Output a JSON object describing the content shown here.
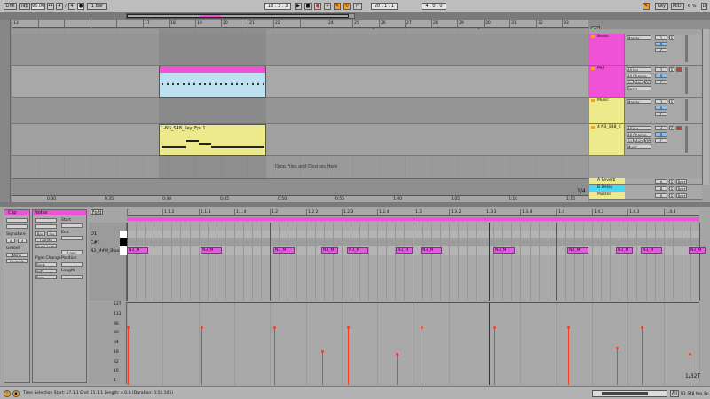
{
  "transport": {
    "link": "Link",
    "tap": "Tap",
    "tempo": "95.00",
    "meter_num": "4",
    "meter_den": "4",
    "quantize": "1 Bar",
    "position": "18 .  3 .  3",
    "loop_start": "20 .  1 .  1",
    "loop_length": "4 .  0 .  0",
    "key": "Key",
    "midi": "MIDI",
    "cpu": "6 %",
    "d_label": "D"
  },
  "arrangement": {
    "ruler_bars": [
      "13",
      "",
      "",
      "",
      "",
      "17",
      "18",
      "19",
      "20",
      "21",
      "22",
      "",
      "24",
      "25",
      "26",
      "27",
      "28",
      "29",
      "30",
      "31",
      "32",
      "33"
    ],
    "time_ticks": [
      "0:30",
      "0:35",
      "0:40",
      "0:45",
      "0:50",
      "0:55",
      "1:00",
      "1:05",
      "1:10",
      "1:15"
    ],
    "drop_text": "Drop Files and Devices Here",
    "clip_name": "1-N3_S48_Key_Epi 1",
    "zoom_ratio": "1/4",
    "set_label": "Set"
  },
  "tracks": [
    {
      "name": "Beats",
      "color": "#ef52d6",
      "routing": "Master",
      "num": "1",
      "vol": "0",
      "pan": "C",
      "extra": ""
    },
    {
      "name": "Perl",
      "color": "#ef52d6",
      "routing": "All Ins",
      "num": "2",
      "vol": "0",
      "pan": "C",
      "extra": "All Channe"
    },
    {
      "name": "Music",
      "color": "#ecea8b",
      "routing": "Master",
      "num": "3",
      "vol": "0",
      "pan": "C",
      "extra": ""
    },
    {
      "name": "4 N3_S48_K",
      "color": "#ecea8b",
      "routing": "All Ins",
      "num": "4",
      "vol": "0",
      "pan": "C",
      "extra": "All Channe"
    }
  ],
  "returns": [
    {
      "name": "A Reverb",
      "color": "#ecea8b",
      "num": "A",
      "btn": "Post"
    },
    {
      "name": "B Delay",
      "color": "#46d8f0",
      "num": "B",
      "btn": "Post"
    },
    {
      "name": "Master",
      "color": "#ecea8b",
      "num": "0",
      "btn": "Post"
    }
  ],
  "mixer_labels": {
    "in": "In",
    "auto": "Auto",
    "off": "Off",
    "music": "Music",
    "beats": "Beats",
    "mast": "Mast",
    "s": "S",
    "one": "1/2"
  },
  "clip_view": {
    "clip_tab": "Clip",
    "notes_tab": "Notes",
    "fold": "Fold",
    "start": "Start",
    "end": "End",
    "signature": "Signature",
    "sig_num": "4",
    "sig_den": "4",
    "groove": "Groove",
    "groove_val": "None",
    "commit": "Commit",
    "pgm_change": "Pgm Change",
    "bank": "Bank",
    "sub": "Sub",
    "pgm": "Pgm",
    "position": "Position",
    "length": "Length",
    "loop": "Loop",
    "legato": "Legato",
    "dupl_loop": "Dupl. Loop",
    "rev": "Rev",
    "inv": "Inv",
    "x2": "x2",
    "half": "÷2"
  },
  "piano_roll": {
    "ruler": [
      "1",
      "1.1.2",
      "1.1.3",
      "1.1.4",
      "1.2",
      "1.2.2",
      "1.2.3",
      "1.2.4",
      "1.3",
      "1.3.2",
      "1.3.3",
      "1.3.4",
      "1.4",
      "1.4.2",
      "1.4.3",
      "1.4.4"
    ],
    "lanes": [
      "D1",
      "C#1",
      "N3_M#M_Blue2"
    ],
    "note_label": "N3_M",
    "velocity_ticks": [
      "127",
      "112",
      "96",
      "80",
      "64",
      "48",
      "32",
      "16",
      "1"
    ],
    "page_ratio": "1/32T",
    "notes": [
      {
        "pos": 0.0,
        "len": 0.037,
        "vel": 96
      },
      {
        "pos": 0.128,
        "len": 0.037,
        "vel": 96
      },
      {
        "pos": 0.256,
        "len": 0.037,
        "vel": 96
      },
      {
        "pos": 0.34,
        "len": 0.03,
        "vel": 56
      },
      {
        "pos": 0.385,
        "len": 0.037,
        "vel": 96
      },
      {
        "pos": 0.47,
        "len": 0.03,
        "vel": 52
      },
      {
        "pos": 0.513,
        "len": 0.037,
        "vel": 96
      },
      {
        "pos": 0.641,
        "len": 0.037,
        "vel": 96
      },
      {
        "pos": 0.769,
        "len": 0.037,
        "vel": 96
      },
      {
        "pos": 0.854,
        "len": 0.03,
        "vel": 62
      },
      {
        "pos": 0.897,
        "len": 0.037,
        "vel": 96
      },
      {
        "pos": 0.982,
        "len": 0.03,
        "vel": 52
      }
    ]
  },
  "status": {
    "text": "Time Selection  Start: 17.1.1   End: 21.1.1   Length: 4.0.0  (Duration: 0:10.105)",
    "track_name": "N3_S48_Key_Ep",
    "all": "All"
  },
  "colors": {
    "accent_orange": "#f2a32c",
    "clip_pink": "#ef52d6",
    "clip_yellow": "#ecea8b",
    "velocity_red": "#ff3a1c",
    "track_blue": "#bfe0f0"
  }
}
